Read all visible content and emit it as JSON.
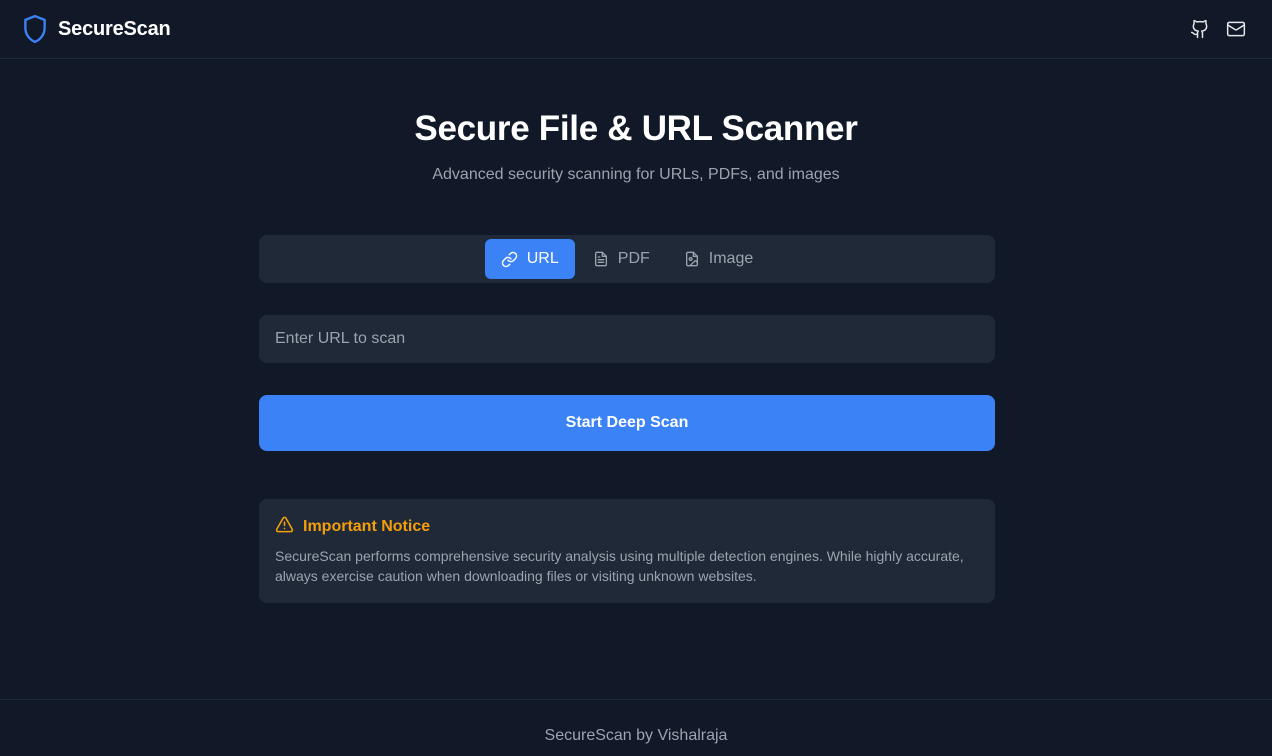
{
  "header": {
    "brand_name": "SecureScan",
    "icons": [
      "shield-icon",
      "github-icon",
      "mail-icon"
    ]
  },
  "hero": {
    "title": "Secure File & URL Scanner",
    "subtitle": "Advanced security scanning for URLs, PDFs, and images"
  },
  "tabs": [
    {
      "label": "URL",
      "icon": "link-icon",
      "active": true
    },
    {
      "label": "PDF",
      "icon": "document-icon",
      "active": false
    },
    {
      "label": "Image",
      "icon": "image-file-icon",
      "active": false
    }
  ],
  "scan_form": {
    "url_value": "",
    "url_placeholder": "Enter URL to scan",
    "submit_label": "Start Deep Scan"
  },
  "notice": {
    "icon": "warning-icon",
    "title": "Important Notice",
    "body": "SecureScan performs comprehensive security analysis using multiple detection engines. While highly accurate, always exercise caution when downloading files or visiting unknown websites."
  },
  "footer": {
    "text": "SecureScan by Vishalraja"
  },
  "colors": {
    "background": "#111827",
    "surface": "#1f2937",
    "accent": "#3b82f6",
    "warning": "#f59e0b",
    "muted_text": "#9ca3af"
  }
}
